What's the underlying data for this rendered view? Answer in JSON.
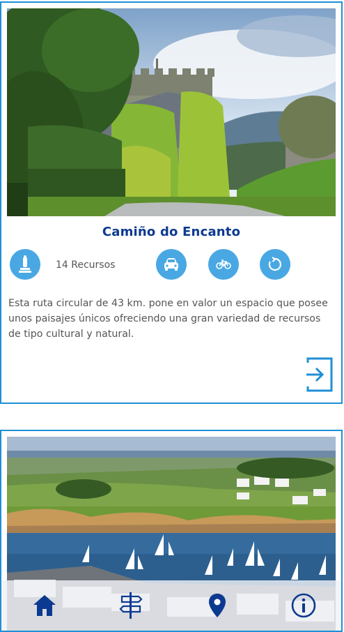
{
  "routes": [
    {
      "title": "Camiño do Encanto",
      "resources_label": "14 Recursos",
      "description": "Esta ruta circular de 43 km. pone en valor un espacio que posee unos paisajes únicos ofreciendo una gran variedad de recursos de tipo cultural y natural.",
      "icons": [
        "monument-icon",
        "car-icon",
        "bicycle-icon",
        "circular-route-icon",
        "enter-icon"
      ]
    }
  ],
  "bottom_nav": {
    "items": [
      "home-icon",
      "signpost-icon",
      "map-pin-icon",
      "info-icon"
    ]
  },
  "colors": {
    "accent": "#1f8fd6",
    "badge": "#49a8e3",
    "title": "#0d3a91",
    "nav_icon": "#0d3a91"
  }
}
